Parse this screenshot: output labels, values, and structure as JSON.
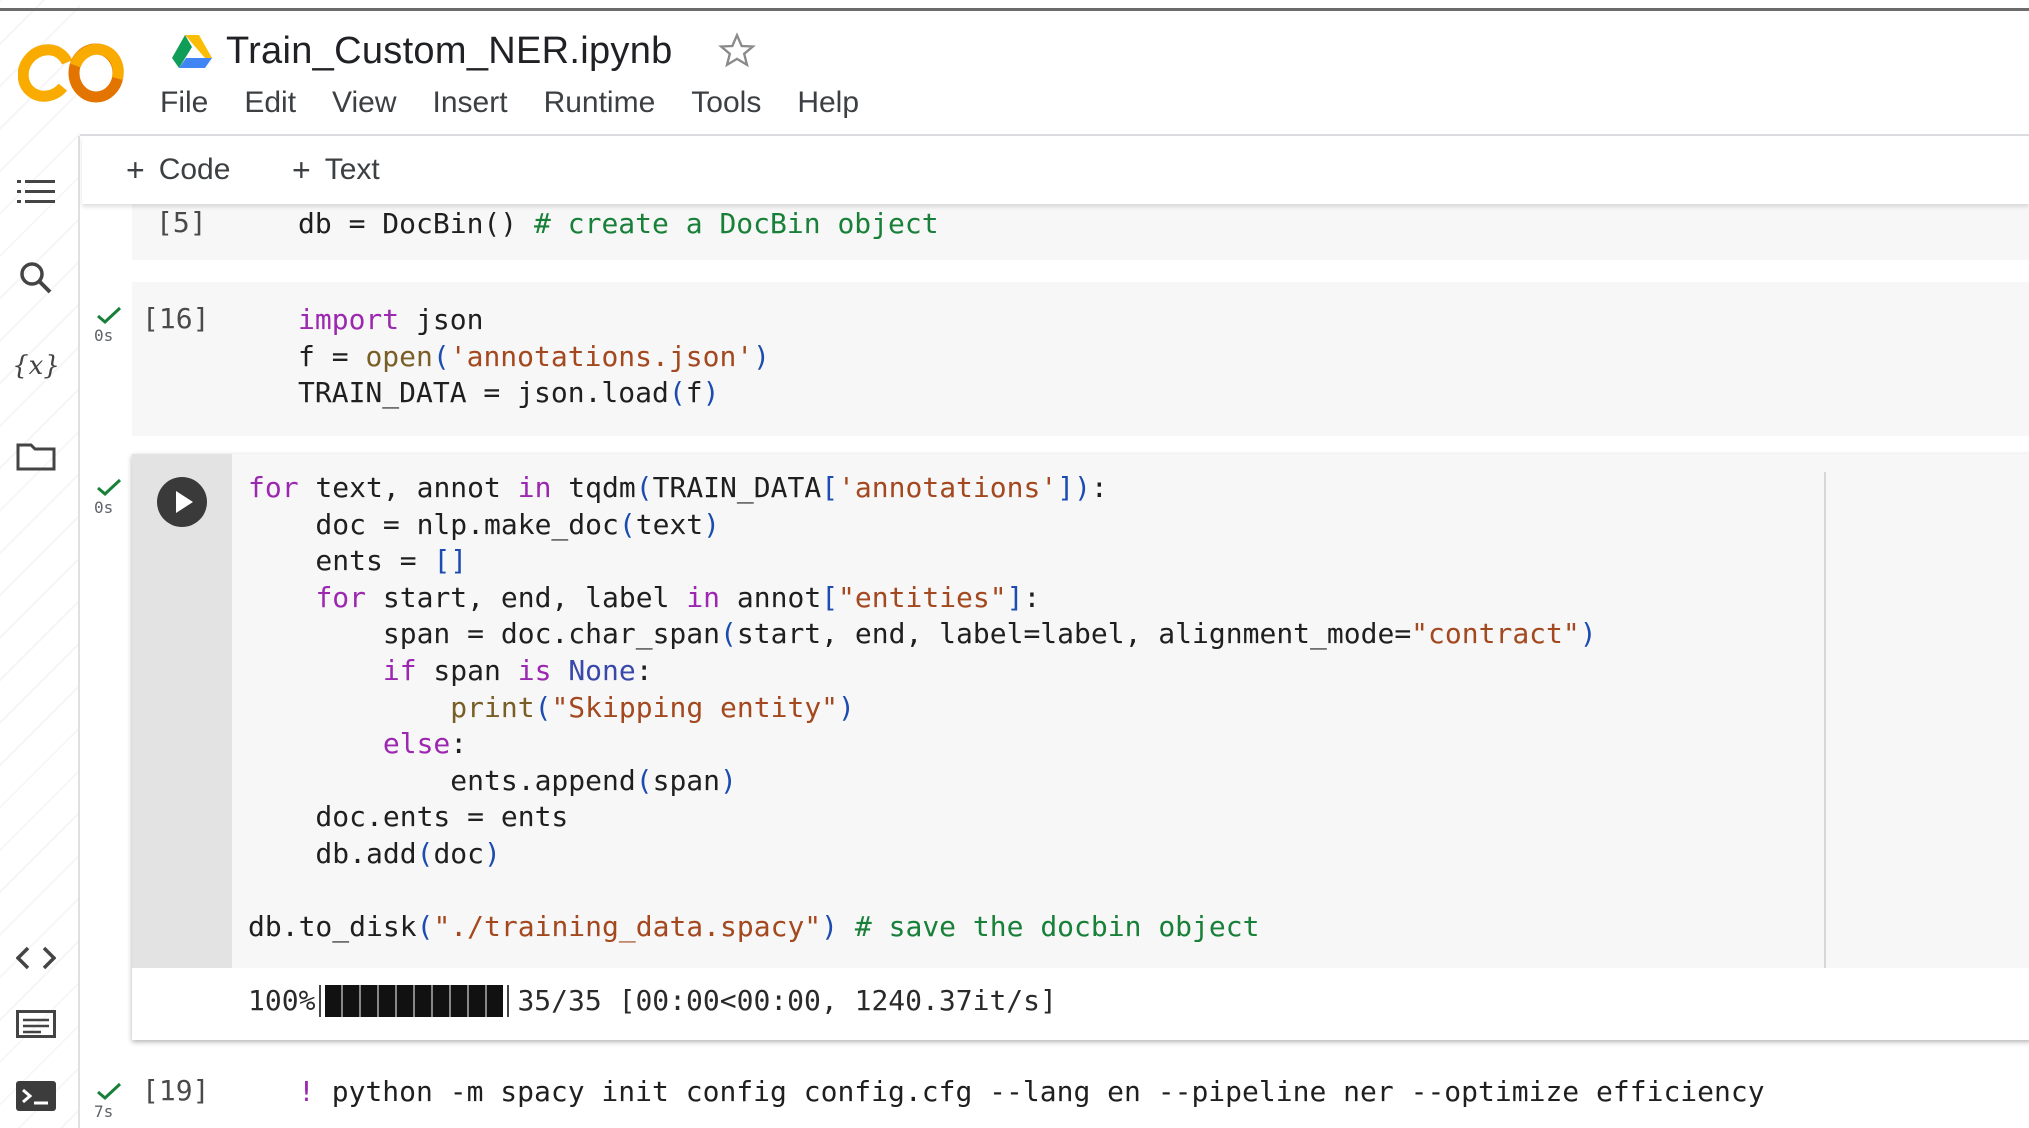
{
  "app": {
    "logo_text": "CO",
    "notebook_title": "Train_Custom_NER.ipynb",
    "menu": [
      "File",
      "Edit",
      "View",
      "Insert",
      "Runtime",
      "Tools",
      "Help"
    ],
    "icons": {
      "logo": "colab-logo",
      "drive": "google-drive-icon",
      "star": "star-icon"
    }
  },
  "rail": {
    "items": [
      "table-of-contents-icon",
      "search-icon",
      "variables-icon",
      "files-icon"
    ],
    "variables_label": "{x}",
    "bottom_items": [
      "code-snippets-icon",
      "command-palette-icon",
      "terminal-icon"
    ]
  },
  "toolbar": {
    "add_code": "Code",
    "add_text": "Text"
  },
  "cells": {
    "c5": {
      "exec": "[5]"
    },
    "c16": {
      "exec": "[16]",
      "time": "0s"
    },
    "c_run": {
      "time": "0s"
    },
    "c19": {
      "exec": "[19]",
      "time": "7s"
    }
  },
  "output": {
    "progress_percent_text": "100%",
    "progress_fraction": 1.0,
    "progress_stats": "35/35 [00:00<00:00, 1240.37it/s]"
  },
  "colors": {
    "keyword": "#9c27b0",
    "string": "#a3481f",
    "comment": "#188038",
    "logo_orange": "#f9ab00",
    "logo_dark_orange": "#e37400"
  }
}
